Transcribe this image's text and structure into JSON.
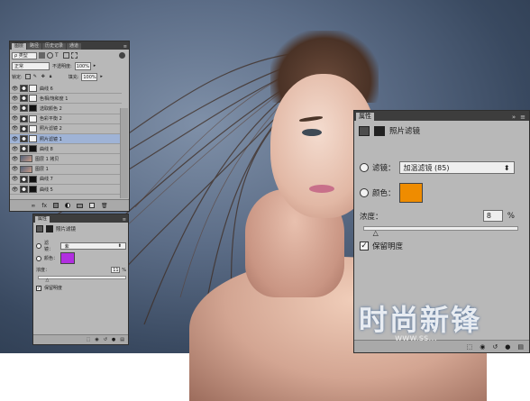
{
  "layers_panel": {
    "tabs": [
      "图层",
      "路径",
      "历史记录",
      "通道"
    ],
    "filter_label": "ρ 类型",
    "blend_mode": "正常",
    "opacity_label": "不透明度:",
    "opacity_value": "100%",
    "lock_label": "锁定:",
    "fill_label": "填充:",
    "fill_value": "100%",
    "layers": [
      {
        "name": "曲线 6",
        "thumb": "white"
      },
      {
        "name": "色相/饱和度 1",
        "thumb": "white"
      },
      {
        "name": "选取颜色 2",
        "thumb": "black"
      },
      {
        "name": "色彩平衡 2",
        "thumb": "white"
      },
      {
        "name": "照片滤镜 2",
        "thumb": "white"
      },
      {
        "name": "照片滤镜 1",
        "thumb": "white",
        "selected": true
      },
      {
        "name": "曲线 8",
        "thumb": "black"
      },
      {
        "name": "图层 1 拷贝",
        "thumb": "photo"
      },
      {
        "name": "图层 1",
        "thumb": "photo"
      },
      {
        "name": "曲线 7",
        "thumb": "black"
      },
      {
        "name": "曲线 5",
        "thumb": "black"
      }
    ]
  },
  "props_small": {
    "title": "属性",
    "header": "照片滤镜",
    "filter_label": "滤镜：",
    "filter_value": "紫",
    "color_label": "颜色：",
    "color_swatch": "#b12ee0",
    "density_label": "浓度：",
    "density_value": "11",
    "density_unit": "%",
    "density_level": 0.11,
    "preserve_label": "保留明度",
    "preserve_checked": true
  },
  "props_large": {
    "title": "属性",
    "header": "照片滤镜",
    "filter_label": "滤镜：",
    "filter_value": "加温滤镜 (85)",
    "color_label": "颜色：",
    "color_swatch": "#ef8c00",
    "density_label": "浓度：",
    "density_value": "8",
    "density_unit": "%",
    "density_level": 0.08,
    "preserve_label": "保留明度",
    "preserve_checked": true
  },
  "watermark": {
    "text": "时尚新锋",
    "url": "www.ss..."
  }
}
